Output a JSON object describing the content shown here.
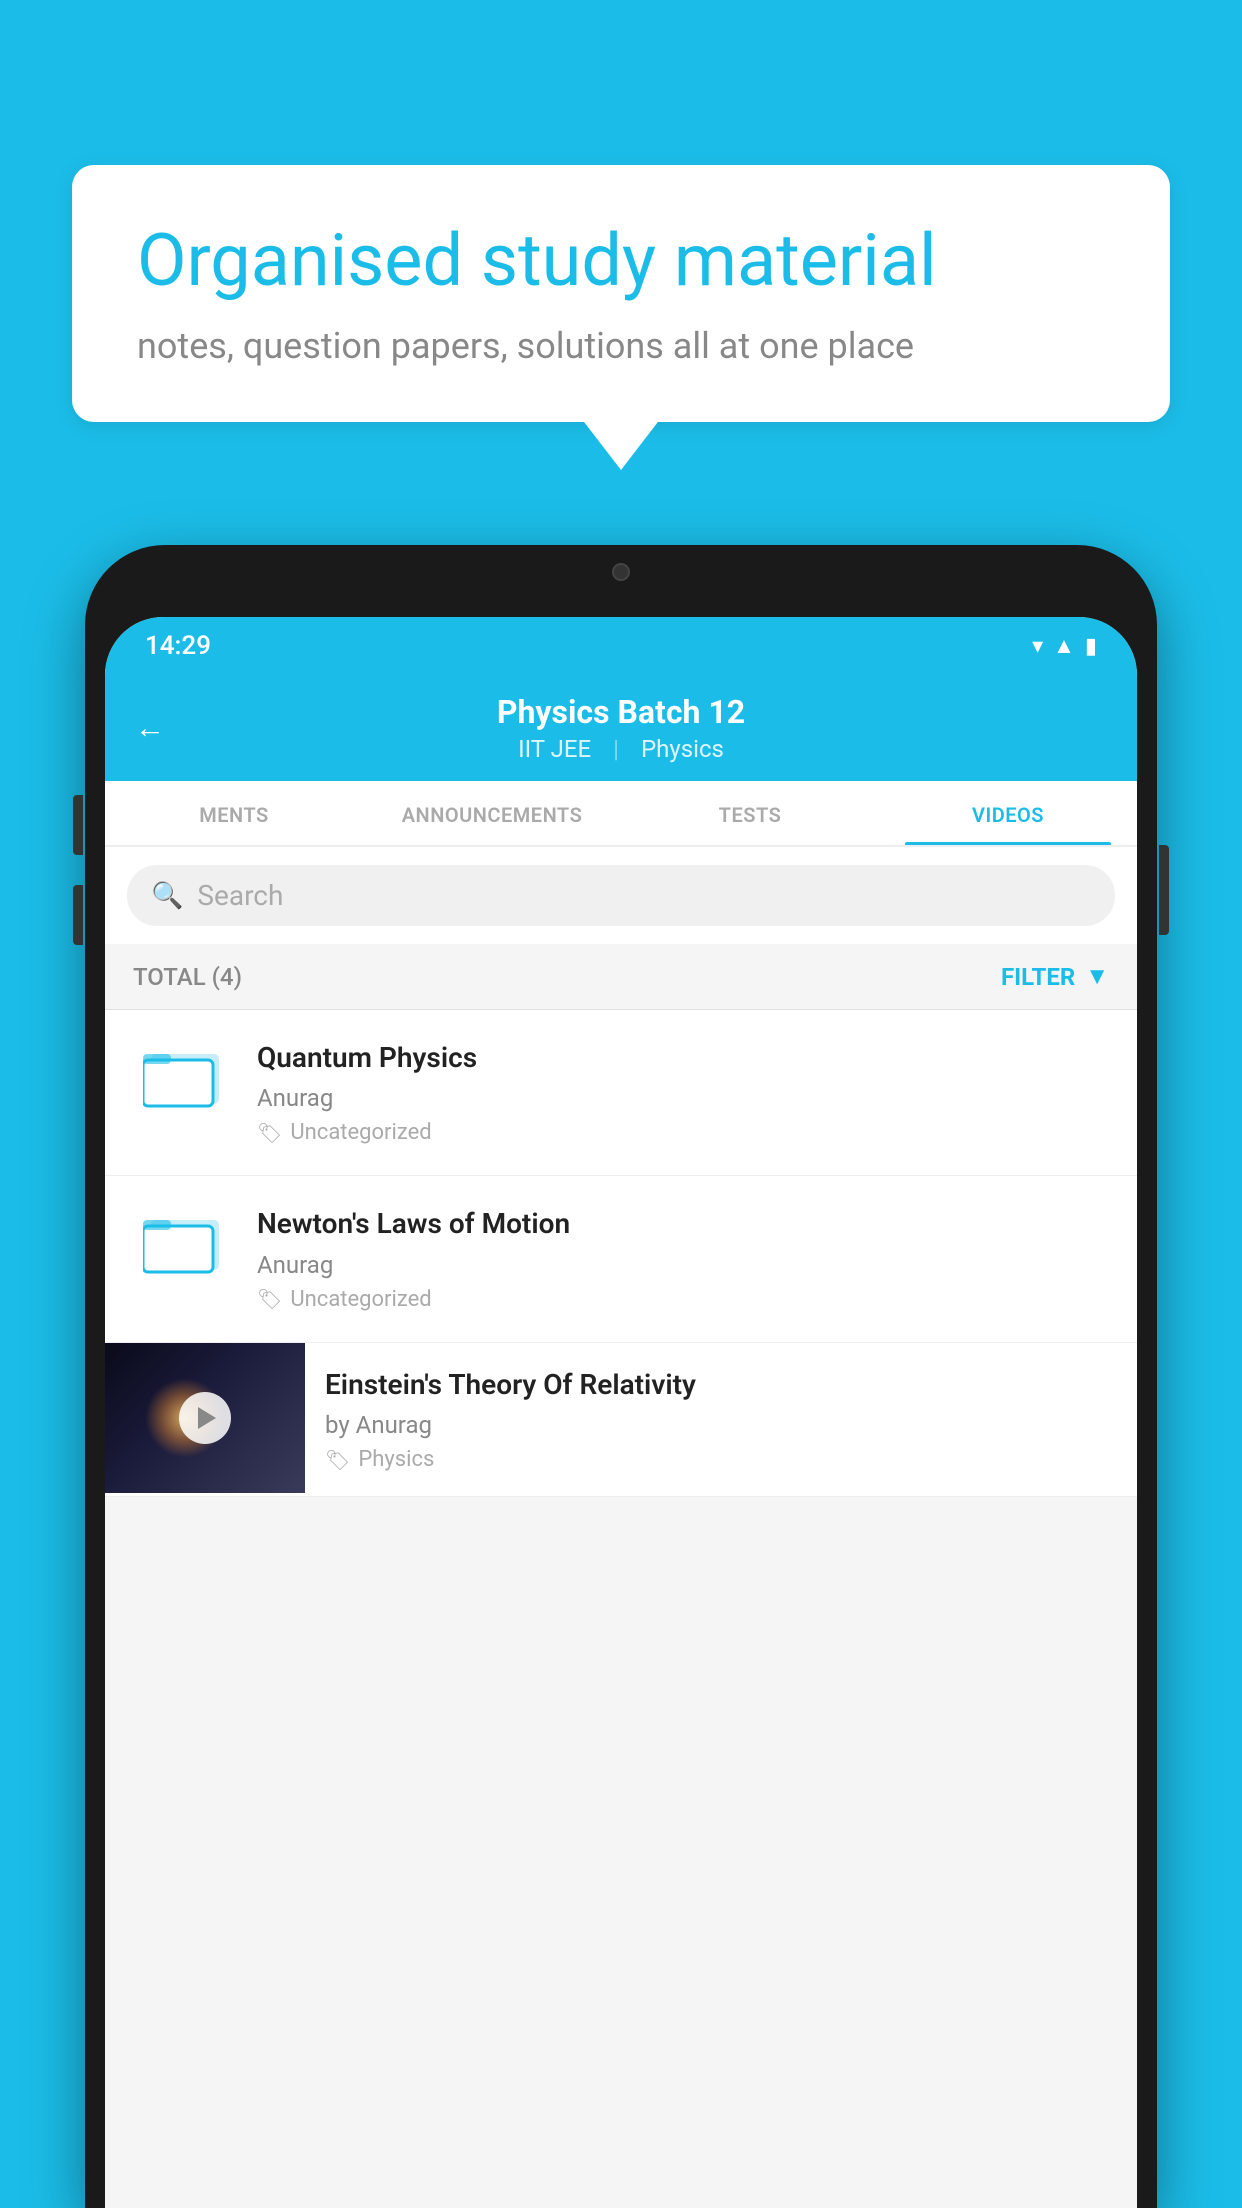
{
  "background_color": "#1BBDE8",
  "speech_bubble": {
    "title": "Organised study material",
    "subtitle": "notes, question papers, solutions all at one place"
  },
  "phone": {
    "status_bar": {
      "time": "14:29",
      "icons": [
        "wifi",
        "signal",
        "battery"
      ]
    },
    "header": {
      "back_label": "←",
      "title": "Physics Batch 12",
      "tag1": "IIT JEE",
      "tag2": "Physics"
    },
    "tabs": [
      {
        "label": "MENTS",
        "active": false
      },
      {
        "label": "ANNOUNCEMENTS",
        "active": false
      },
      {
        "label": "TESTS",
        "active": false
      },
      {
        "label": "VIDEOS",
        "active": true
      }
    ],
    "search": {
      "placeholder": "Search"
    },
    "filter_bar": {
      "total_label": "TOTAL (4)",
      "filter_label": "FILTER"
    },
    "videos": [
      {
        "id": 1,
        "title": "Quantum Physics",
        "author": "Anurag",
        "tag": "Uncategorized",
        "has_thumbnail": false
      },
      {
        "id": 2,
        "title": "Newton's Laws of Motion",
        "author": "Anurag",
        "tag": "Uncategorized",
        "has_thumbnail": false
      },
      {
        "id": 3,
        "title": "Einstein's Theory Of Relativity",
        "author": "by Anurag",
        "tag": "Physics",
        "has_thumbnail": true
      }
    ]
  }
}
